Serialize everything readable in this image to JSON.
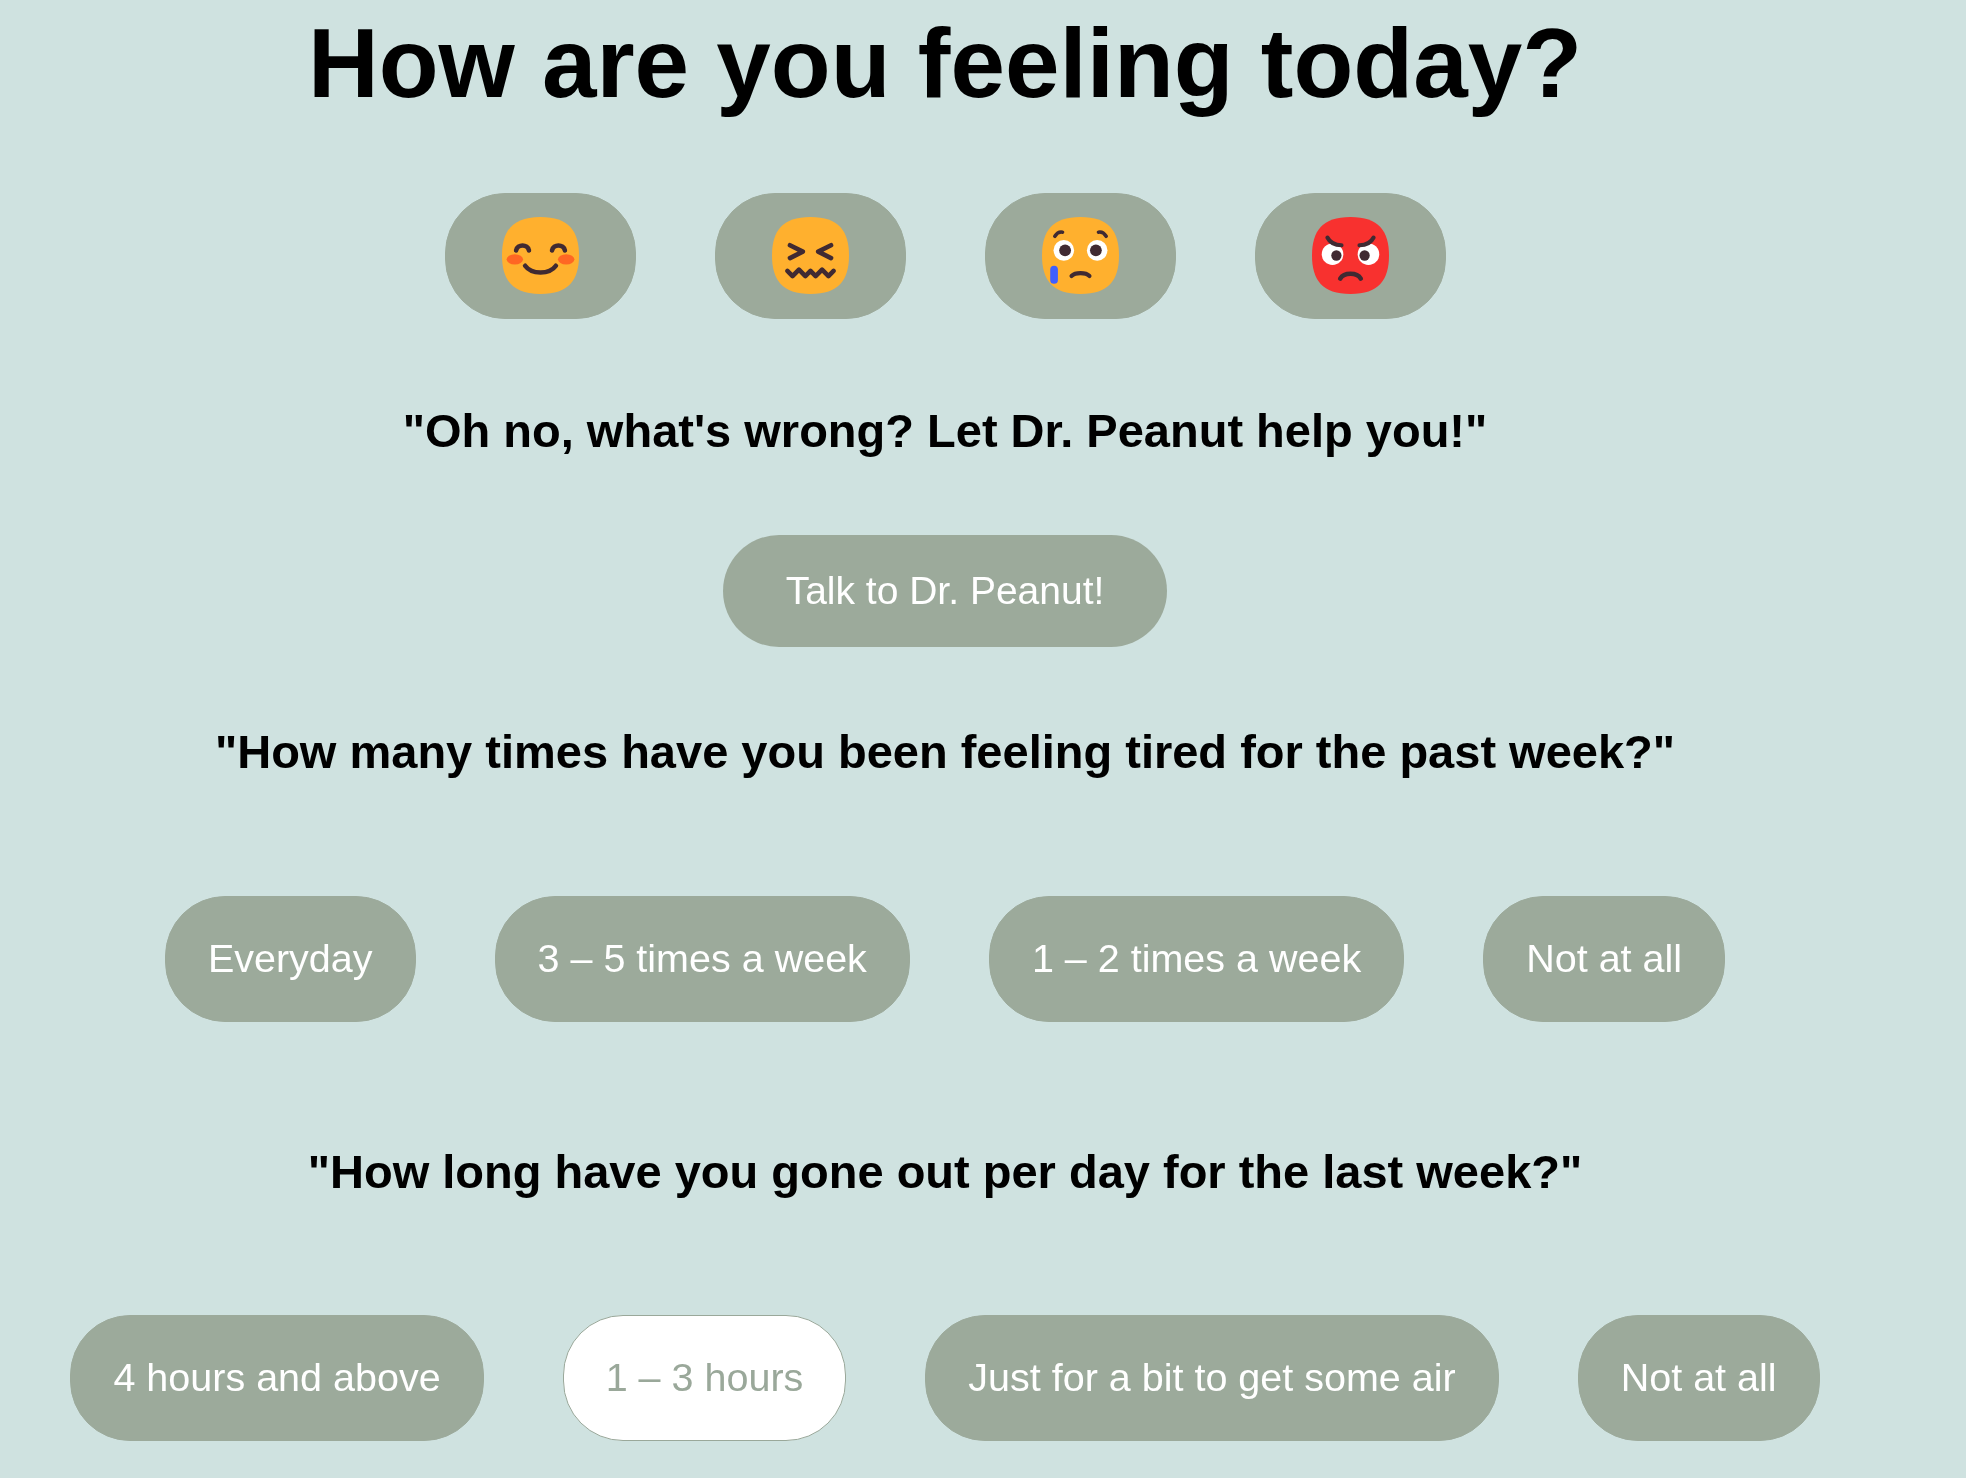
{
  "title": "How are you feeling today?",
  "moods": [
    {
      "selected": false
    },
    {
      "selected": false
    },
    {
      "selected": false
    },
    {
      "selected": false
    }
  ],
  "message": "\"Oh no, what's wrong? Let Dr. Peanut help you!\"",
  "talk_button": {
    "label": "Talk to Dr. Peanut!"
  },
  "questions": [
    {
      "prompt": "\"How many times have you been feeling tired for the past week?\"",
      "options": [
        {
          "label": "Everyday",
          "selected": false
        },
        {
          "label": "3 – 5 times a week",
          "selected": false
        },
        {
          "label": "1 – 2 times a week",
          "selected": false
        },
        {
          "label": "Not at all",
          "selected": false
        }
      ]
    },
    {
      "prompt": "\"How long have you gone out per day for the last week?\"",
      "options": [
        {
          "label": "4 hours and above",
          "selected": false
        },
        {
          "label": "1 – 3 hours",
          "selected": true
        },
        {
          "label": "Just for a bit to get some air",
          "selected": false
        },
        {
          "label": "Not at all",
          "selected": false
        }
      ]
    }
  ]
}
